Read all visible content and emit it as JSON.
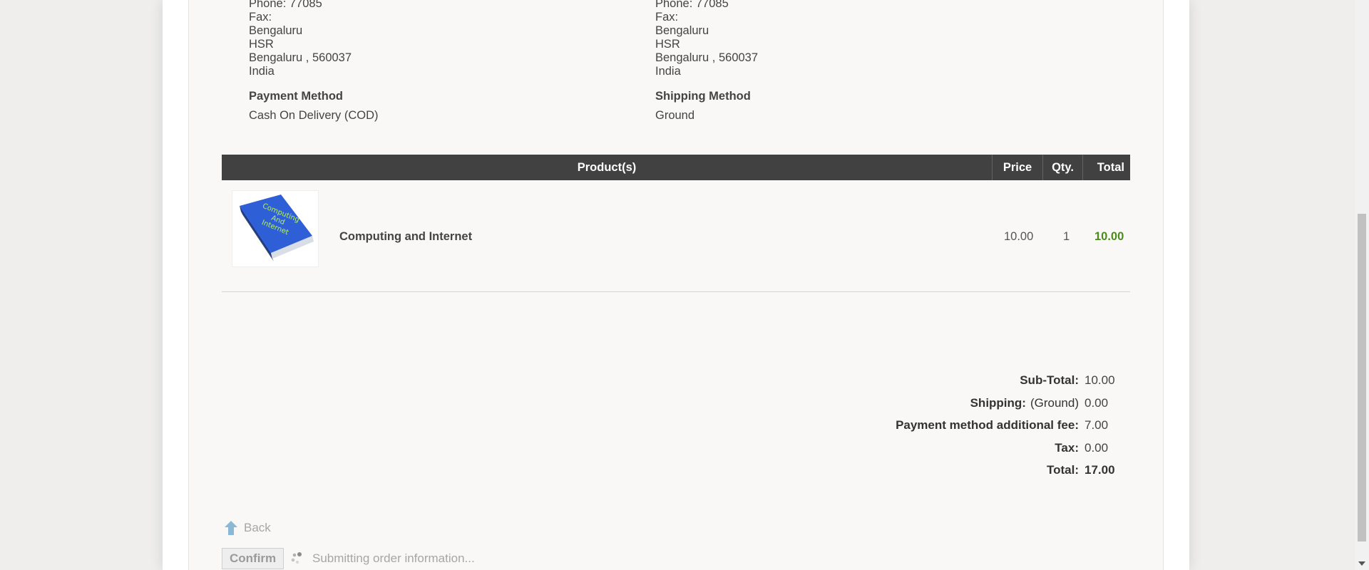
{
  "billing_address": {
    "lines": [
      "Phone: 77085",
      "Fax:",
      "Bengaluru",
      "HSR",
      "Bengaluru , 560037",
      "India"
    ]
  },
  "shipping_address": {
    "lines": [
      "Phone: 77085",
      "Fax:",
      "Bengaluru",
      "HSR",
      "Bengaluru , 560037",
      "India"
    ]
  },
  "payment": {
    "title": "Payment Method",
    "value": "Cash On Delivery (COD)"
  },
  "shipping": {
    "title": "Shipping Method",
    "value": "Ground"
  },
  "cart": {
    "headers": {
      "product": "Product(s)",
      "price": "Price",
      "qty": "Qty.",
      "total": "Total"
    },
    "items": [
      {
        "name": "Computing and Internet",
        "price": "10.00",
        "qty": "1",
        "total": "10.00",
        "image_text": [
          "Computing",
          "And",
          "Internet"
        ]
      }
    ]
  },
  "totals": {
    "subtotal": {
      "label": "Sub-Total:",
      "value": "10.00"
    },
    "shipping": {
      "label": "Shipping:",
      "sub": "(Ground)",
      "value": "0.00"
    },
    "fee": {
      "label": "Payment method additional fee:",
      "value": "7.00"
    },
    "tax": {
      "label": "Tax:",
      "value": "0.00"
    },
    "total": {
      "label": "Total:",
      "value": "17.00"
    }
  },
  "actions": {
    "back_label": "Back",
    "confirm_label": "Confirm",
    "submitting_text": "Submitting order information..."
  },
  "colors": {
    "header_bg": "#414141",
    "total_green": "#4b8b1c",
    "book_blue": "#2f5fd6"
  }
}
